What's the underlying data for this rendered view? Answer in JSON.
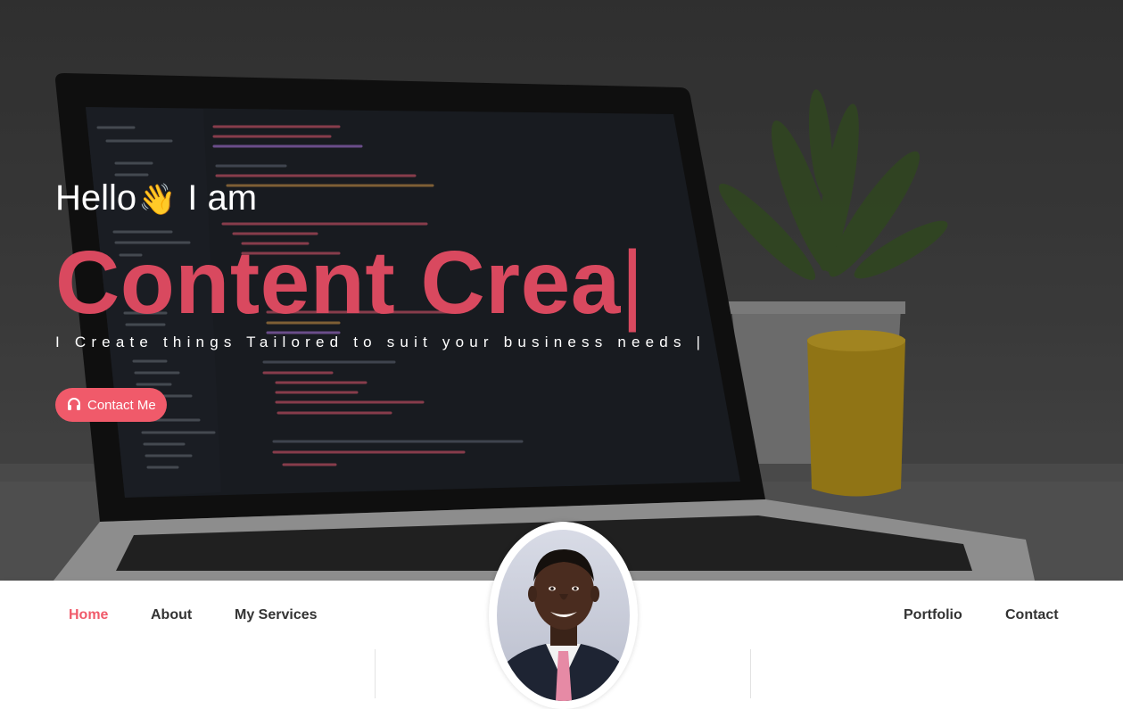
{
  "hero": {
    "greeting_prefix": "Hello",
    "greeting_emoji": "👋",
    "greeting_suffix": "I am",
    "headline": "Content Crea",
    "headline_cursor": "|",
    "subline": "I Create things Tailored to suit your business needs |",
    "contact_button_label": "Contact Me",
    "contact_button_icon": "headset-icon",
    "accent_color": "#f05a6a",
    "headline_color": "#d9495f"
  },
  "nav": {
    "items": [
      {
        "label": "Home",
        "active": true
      },
      {
        "label": "About",
        "active": false
      },
      {
        "label": "My Services",
        "active": false
      },
      {
        "label": "Portfolio",
        "active": false
      },
      {
        "label": "Contact",
        "active": false
      }
    ]
  },
  "avatar": {
    "icon": "profile-photo"
  }
}
